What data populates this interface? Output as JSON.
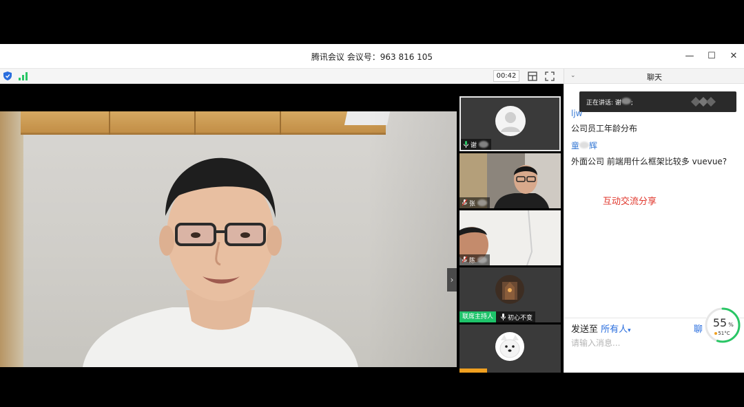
{
  "window": {
    "title": "腾讯会议 会议号：963 816 105",
    "controls": [
      "—",
      "☐",
      "✕"
    ]
  },
  "toolbar": {
    "timer": "00:42",
    "icons": [
      "shield-icon",
      "signal-icon",
      "layout-icon",
      "fullscreen-icon"
    ]
  },
  "participants": [
    {
      "name_prefix": "谢",
      "mic": "mic-on",
      "video": "avatar-default",
      "active": true
    },
    {
      "name_prefix": "张",
      "mic": "mic-muted",
      "video": "camera"
    },
    {
      "name_prefix": "陈",
      "mic": "mic-muted",
      "video": "camera"
    },
    {
      "badge": "联席主持人",
      "name": "初心不变",
      "mic": "mic-on",
      "video": "avatar-image"
    },
    {
      "name_prefix": "",
      "mic": "",
      "video": "avatar-dog"
    }
  ],
  "chat": {
    "title": "聊天",
    "collapse": "⌄",
    "speaking_label": "正在讲话: 谢",
    "speaking_suffix": ";",
    "messages": [
      {
        "sender": "ljw",
        "text": "公司员工年龄分布"
      },
      {
        "sender": "童",
        "sender_suffix": "辉",
        "text": "外面公司 前端用什么框架比较多  vuevue?"
      }
    ],
    "note": "互动交流分享",
    "send_to_label": "发送至",
    "send_to_value": "所有人",
    "send_to_arrow": "▾",
    "chat_button": "聊",
    "input_placeholder": "请输入消息..."
  },
  "gauge": {
    "percent": "55",
    "unit": "%",
    "temperature": "51°C",
    "value": 0.55
  },
  "colors": {
    "accent": "#2a6ede",
    "host_badge": "#1ec36a",
    "note": "#e0362b",
    "gauge": "#29c665"
  }
}
